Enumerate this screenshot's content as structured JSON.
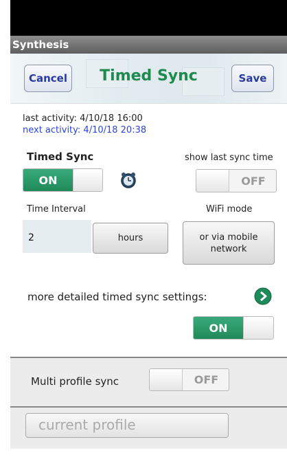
{
  "app": {
    "title": "Synthesis"
  },
  "header": {
    "cancel_label": "Cancel",
    "title": "Timed Sync",
    "save_label": "Save"
  },
  "activity": {
    "last": "last activity:  4/10/18  16:00",
    "next": "next activity: 4/10/18  20:38"
  },
  "timed_sync": {
    "label": "Timed Sync",
    "toggle_state": "ON"
  },
  "show_last_sync": {
    "label": "show last sync time",
    "toggle_state": "OFF"
  },
  "interval": {
    "label": "Time Interval",
    "value": "2",
    "unit_label": "hours"
  },
  "wifi": {
    "label": "WiFi mode",
    "button_line1": "or via mobile",
    "button_line2": "network"
  },
  "detailed": {
    "label": "more detailed timed sync settings:",
    "toggle_state": "ON"
  },
  "multi_profile": {
    "label": "Multi profile sync",
    "toggle_state": "OFF"
  },
  "current_profile": {
    "label": "current profile"
  },
  "colors": {
    "accent_green": "#218a5a",
    "title_green": "#1e8a50",
    "link_blue": "#2c45d6"
  }
}
